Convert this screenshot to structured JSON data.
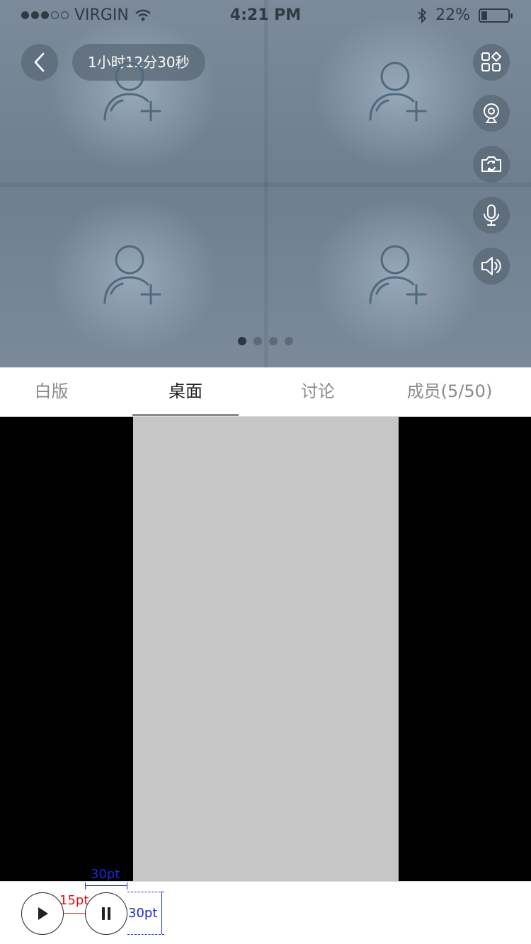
{
  "status_bar": {
    "carrier": "VIRGIN",
    "time": "4:21 PM",
    "battery_percent": "22%",
    "battery_level": 0.22,
    "signal_bars_filled": 3,
    "signal_bars_total": 5
  },
  "call": {
    "duration": "1小时12分30秒"
  },
  "video_slots": [
    {
      "icon": "add-member-icon"
    },
    {
      "icon": "add-member-icon"
    },
    {
      "icon": "add-member-icon"
    },
    {
      "icon": "add-member-icon"
    }
  ],
  "controls": [
    {
      "icon": "apps-grid-icon"
    },
    {
      "icon": "webcam-icon"
    },
    {
      "icon": "switch-camera-icon"
    },
    {
      "icon": "microphone-icon"
    },
    {
      "icon": "speaker-icon"
    }
  ],
  "pager": {
    "count": 4,
    "active_index": 0
  },
  "tabs": [
    {
      "label": "白版",
      "active": false
    },
    {
      "label": "桌面",
      "active": true
    },
    {
      "label": "讨论",
      "active": false
    },
    {
      "label": "成员(5/50)",
      "active": false
    }
  ],
  "bottom_bar": {
    "buttons": [
      {
        "icon": "play-icon"
      },
      {
        "icon": "pause-icon"
      }
    ],
    "annotations": {
      "button_width": "30pt",
      "button_gap": "15pt",
      "button_height": "30pt"
    }
  },
  "colors": {
    "video_bg": "#6f7f8f",
    "control_bg": "#5a6876",
    "desktop_bg": "#000000",
    "shared_screen": "#c6c6c6",
    "annotation_blue": "#1a2bd6",
    "annotation_red": "#e01010"
  }
}
